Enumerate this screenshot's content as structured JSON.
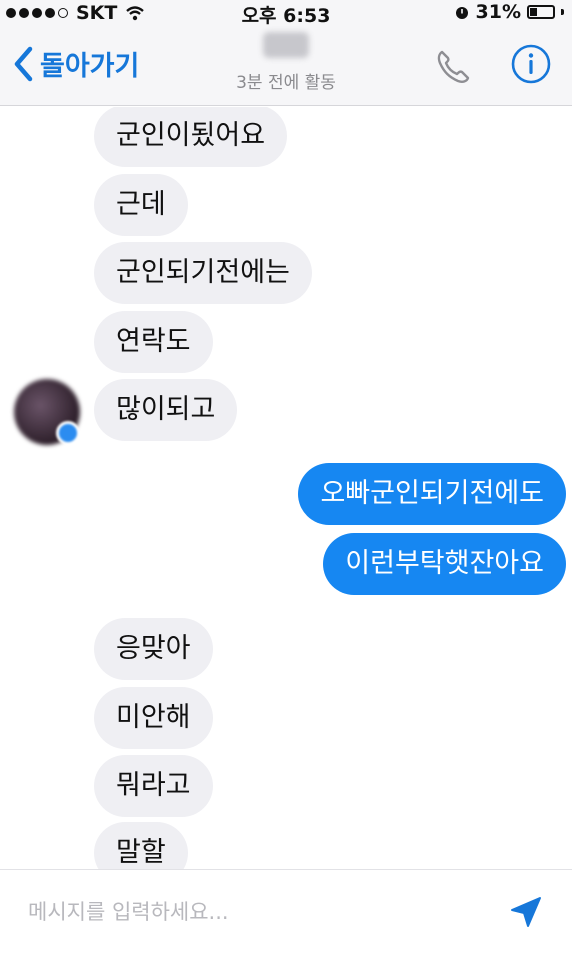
{
  "status_bar": {
    "carrier": "SKT",
    "time": "오후 6:53",
    "battery": "31%",
    "battery_level": 0.31,
    "signal_bars_filled": 4,
    "signal_bars_total": 5
  },
  "header": {
    "back_label": "돌아가기",
    "contact_status": "3분 전에 활동",
    "phone_icon": "phone-icon",
    "info_icon": "info-icon"
  },
  "messages": [
    {
      "side": "in",
      "text": "군인이됬어요"
    },
    {
      "side": "in",
      "text": "근데"
    },
    {
      "side": "in",
      "text": "군인되기전에는"
    },
    {
      "side": "in",
      "text": "연락도"
    },
    {
      "side": "in",
      "text": "많이되고"
    },
    {
      "side": "out",
      "text": "오빠군인되기전에도"
    },
    {
      "side": "out",
      "text": "이런부탁햇잔아요"
    },
    {
      "side": "in",
      "text": "응맞아"
    },
    {
      "side": "in",
      "text": "미안해"
    },
    {
      "side": "in",
      "text": "뭐라고"
    },
    {
      "side": "in",
      "text": "말할"
    }
  ],
  "composer": {
    "placeholder": "메시지를 입력하세요...",
    "send_icon": "send-icon"
  },
  "colors": {
    "accent": "#1677d9",
    "outgoing_bubble": "#1687f2",
    "incoming_bubble": "#efeff3"
  }
}
